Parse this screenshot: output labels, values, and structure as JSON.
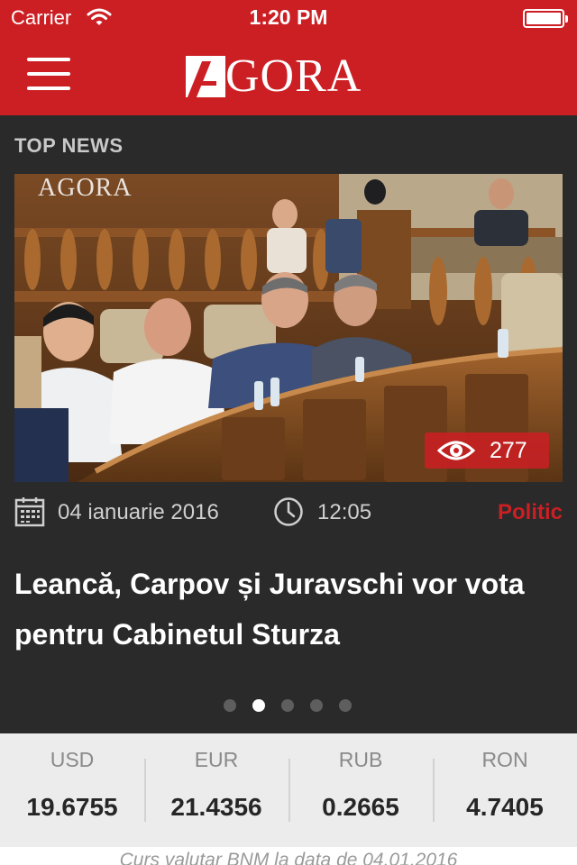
{
  "status_bar": {
    "carrier": "Carrier",
    "time": "1:20 PM",
    "icons": [
      "wifi-icon",
      "battery-icon"
    ]
  },
  "header": {
    "logo_text": "GORA",
    "logo_letter": "A",
    "menu_icon": "hamburger-menu-icon",
    "brand_color": "#cc1f24"
  },
  "section": {
    "title": "TOP NEWS"
  },
  "article": {
    "image_watermark": "AGORA",
    "views": "277",
    "date": "04 ianuarie 2016",
    "time": "12:05",
    "category": "Politic",
    "title": "Leancă, Carpov și Juravschi vor vota pentru Cabinetul Sturza"
  },
  "carousel": {
    "total": 5,
    "active_index": 1
  },
  "rates": {
    "items": [
      {
        "code": "USD",
        "value": "19.6755"
      },
      {
        "code": "EUR",
        "value": "21.4356"
      },
      {
        "code": "RUB",
        "value": "0.2665"
      },
      {
        "code": "RON",
        "value": "4.7405"
      }
    ],
    "note": "Curs valutar BNM la data de 04.01.2016"
  }
}
